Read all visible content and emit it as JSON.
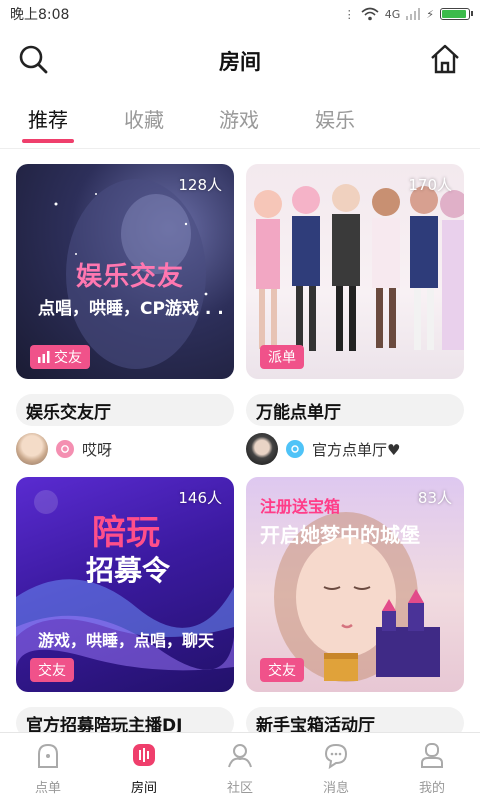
{
  "status": {
    "time": "晚上8:08",
    "network": "4G"
  },
  "header": {
    "title": "房间",
    "search_icon": "search-icon",
    "home_icon": "home-icon"
  },
  "tabs": [
    {
      "label": "推荐",
      "active": true
    },
    {
      "label": "收藏",
      "active": false
    },
    {
      "label": "游戏",
      "active": false
    },
    {
      "label": "娱乐",
      "active": false
    }
  ],
  "rooms": [
    {
      "count": "128人",
      "tag": "交友",
      "title": "娱乐交友厅",
      "host": "哎呀",
      "poster_line1": "娱乐交友",
      "poster_line2": "点唱，哄睡，CP游戏 . .",
      "host_icon_color": "#f06292"
    },
    {
      "count": "170人",
      "tag": "派单",
      "title": "万能点单厅",
      "host": "官方点单厅♥",
      "host_icon_color": "#4fc3f7"
    },
    {
      "count": "146人",
      "tag": "交友",
      "title": "官方招募陪玩主播DJ",
      "poster_line1": "陪玩",
      "poster_line2": "招募令",
      "poster_line3": "游戏，哄睡，点唱，聊天"
    },
    {
      "count": "83人",
      "tag": "交友",
      "title": "新手宝箱活动厅",
      "poster_line1": "注册送宝箱",
      "poster_line2": "开启她梦中的城堡"
    }
  ],
  "nav": [
    {
      "label": "点单",
      "icon": "order-icon",
      "active": false
    },
    {
      "label": "房间",
      "icon": "room-icon",
      "active": true
    },
    {
      "label": "社区",
      "icon": "community-icon",
      "active": false
    },
    {
      "label": "消息",
      "icon": "message-icon",
      "active": false
    },
    {
      "label": "我的",
      "icon": "profile-icon",
      "active": false
    }
  ],
  "colors": {
    "accent": "#ef3f6c",
    "tag_bg": "#f0528a",
    "title_bar_bg": "#f2f2f2"
  }
}
